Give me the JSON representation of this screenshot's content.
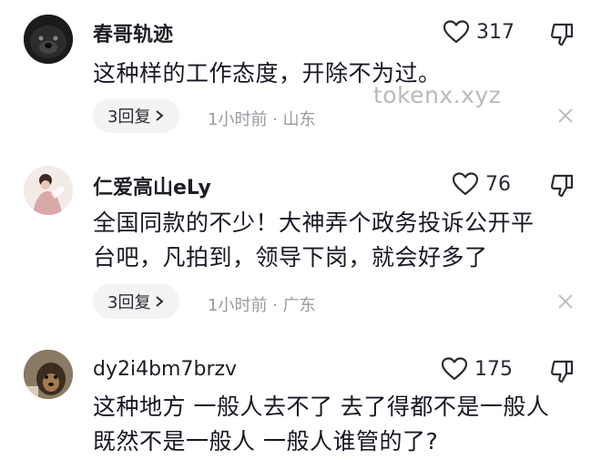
{
  "watermark": "tokenx.xyz",
  "comments": [
    {
      "username": "春哥轨迹",
      "likes": "317",
      "text_lines": [
        "这种样的工作态度，开除不为过。"
      ],
      "replies_label": "3回复",
      "meta": "1小时前 · 山东",
      "avatar": "dog-avatar"
    },
    {
      "username": "仁爱高山eLy",
      "likes": "76",
      "text_lines": [
        "全国同款的不少！大神弄个政务投诉公开平",
        "台吧，凡拍到，领导下岗，就会好多了"
      ],
      "replies_label": "3回复",
      "meta": "1小时前 · 广东",
      "avatar": "girl-avatar"
    },
    {
      "username": "dy2i4bm7brzv",
      "likes": "175",
      "text_lines": [
        "这种地方 一般人去不了 去了得都不是一般人",
        "既然不是一般人 一般人谁管的了?"
      ],
      "avatar": "puppy-avatar"
    }
  ],
  "icons": {
    "like": "heart-outline-icon",
    "dislike": "thumbs-down-outline-icon",
    "expand": "chevron-right-icon",
    "close": "close-icon"
  }
}
